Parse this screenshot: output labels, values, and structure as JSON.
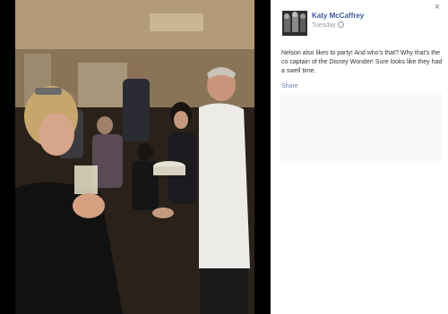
{
  "photo": {
    "description_icon": "photo"
  },
  "post": {
    "author": "Katy McCaffrey",
    "timestamp": "Tuesday",
    "privacy_icon": "globe-icon",
    "caption": "Nelson also likes to party! And who's that? Why that's the co captain of the Disney Wonder! Sure looks like they had a swell time.",
    "share_label": "Share"
  },
  "controls": {
    "close_label": "×"
  },
  "colors": {
    "link": "#3b5998",
    "meta": "#9197a3",
    "stage": "#000000"
  }
}
